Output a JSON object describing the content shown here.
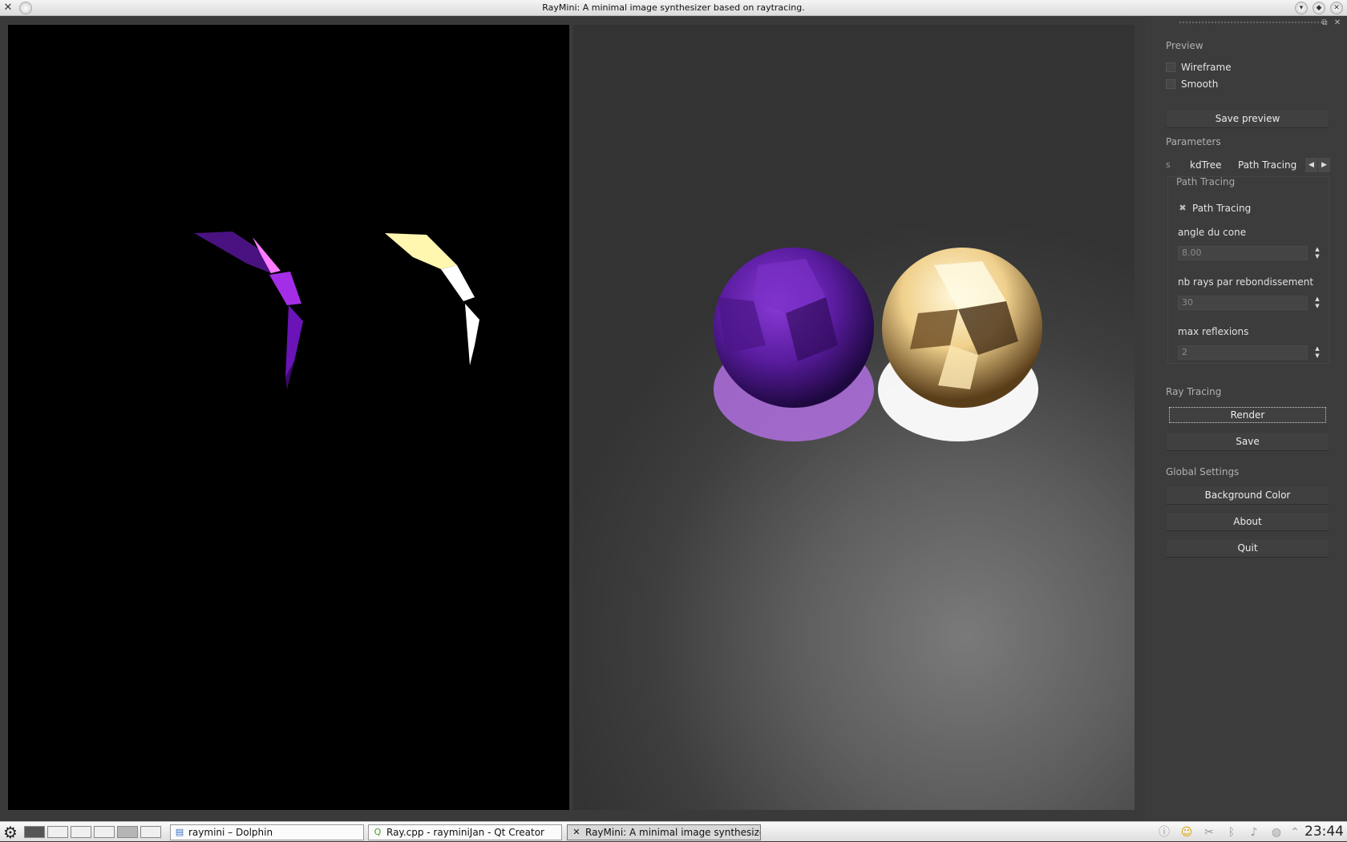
{
  "window": {
    "title": "RayMini: A minimal image synthesizer based on raytracing.",
    "app_icon": "kde-x-icon",
    "buttons": [
      "minimize-icon",
      "maximize-icon",
      "close-icon"
    ]
  },
  "panel": {
    "preview_title": "Preview",
    "wireframe_label": "Wireframe",
    "smooth_label": "Smooth",
    "save_preview_label": "Save preview",
    "parameters_title": "Parameters",
    "tabs": {
      "partial": "ꜱ",
      "kdtree": "kdTree",
      "path_tracing": "Path Tracing"
    },
    "path_tracing_group": {
      "title": "Path Tracing",
      "checkbox_label": "Path Tracing",
      "angle_label": "angle du cone",
      "angle_value": "8.00",
      "rays_label": "nb rays par rebondissement",
      "rays_value": "30",
      "reflexions_label": "max reflexions",
      "reflexions_value": "2"
    },
    "ray_tracing_title": "Ray Tracing",
    "render_label": "Render",
    "save_label": "Save",
    "global_title": "Global Settings",
    "background_color_label": "Background Color",
    "about_label": "About",
    "quit_label": "Quit"
  },
  "taskbar": {
    "tasks": [
      {
        "label": "raymini – Dolphin",
        "icon": "dolphin-icon"
      },
      {
        "label": "Ray.cpp - rayminiJan - Qt Creator",
        "icon": "qt-creator-icon"
      },
      {
        "label": "RayMini: A minimal image synthesizer b",
        "icon": "kde-x-icon"
      }
    ],
    "clock": "23:44"
  },
  "scene": {
    "sphere_left_color": "#6a1fb0",
    "sphere_right_color": "#f3d79a"
  }
}
